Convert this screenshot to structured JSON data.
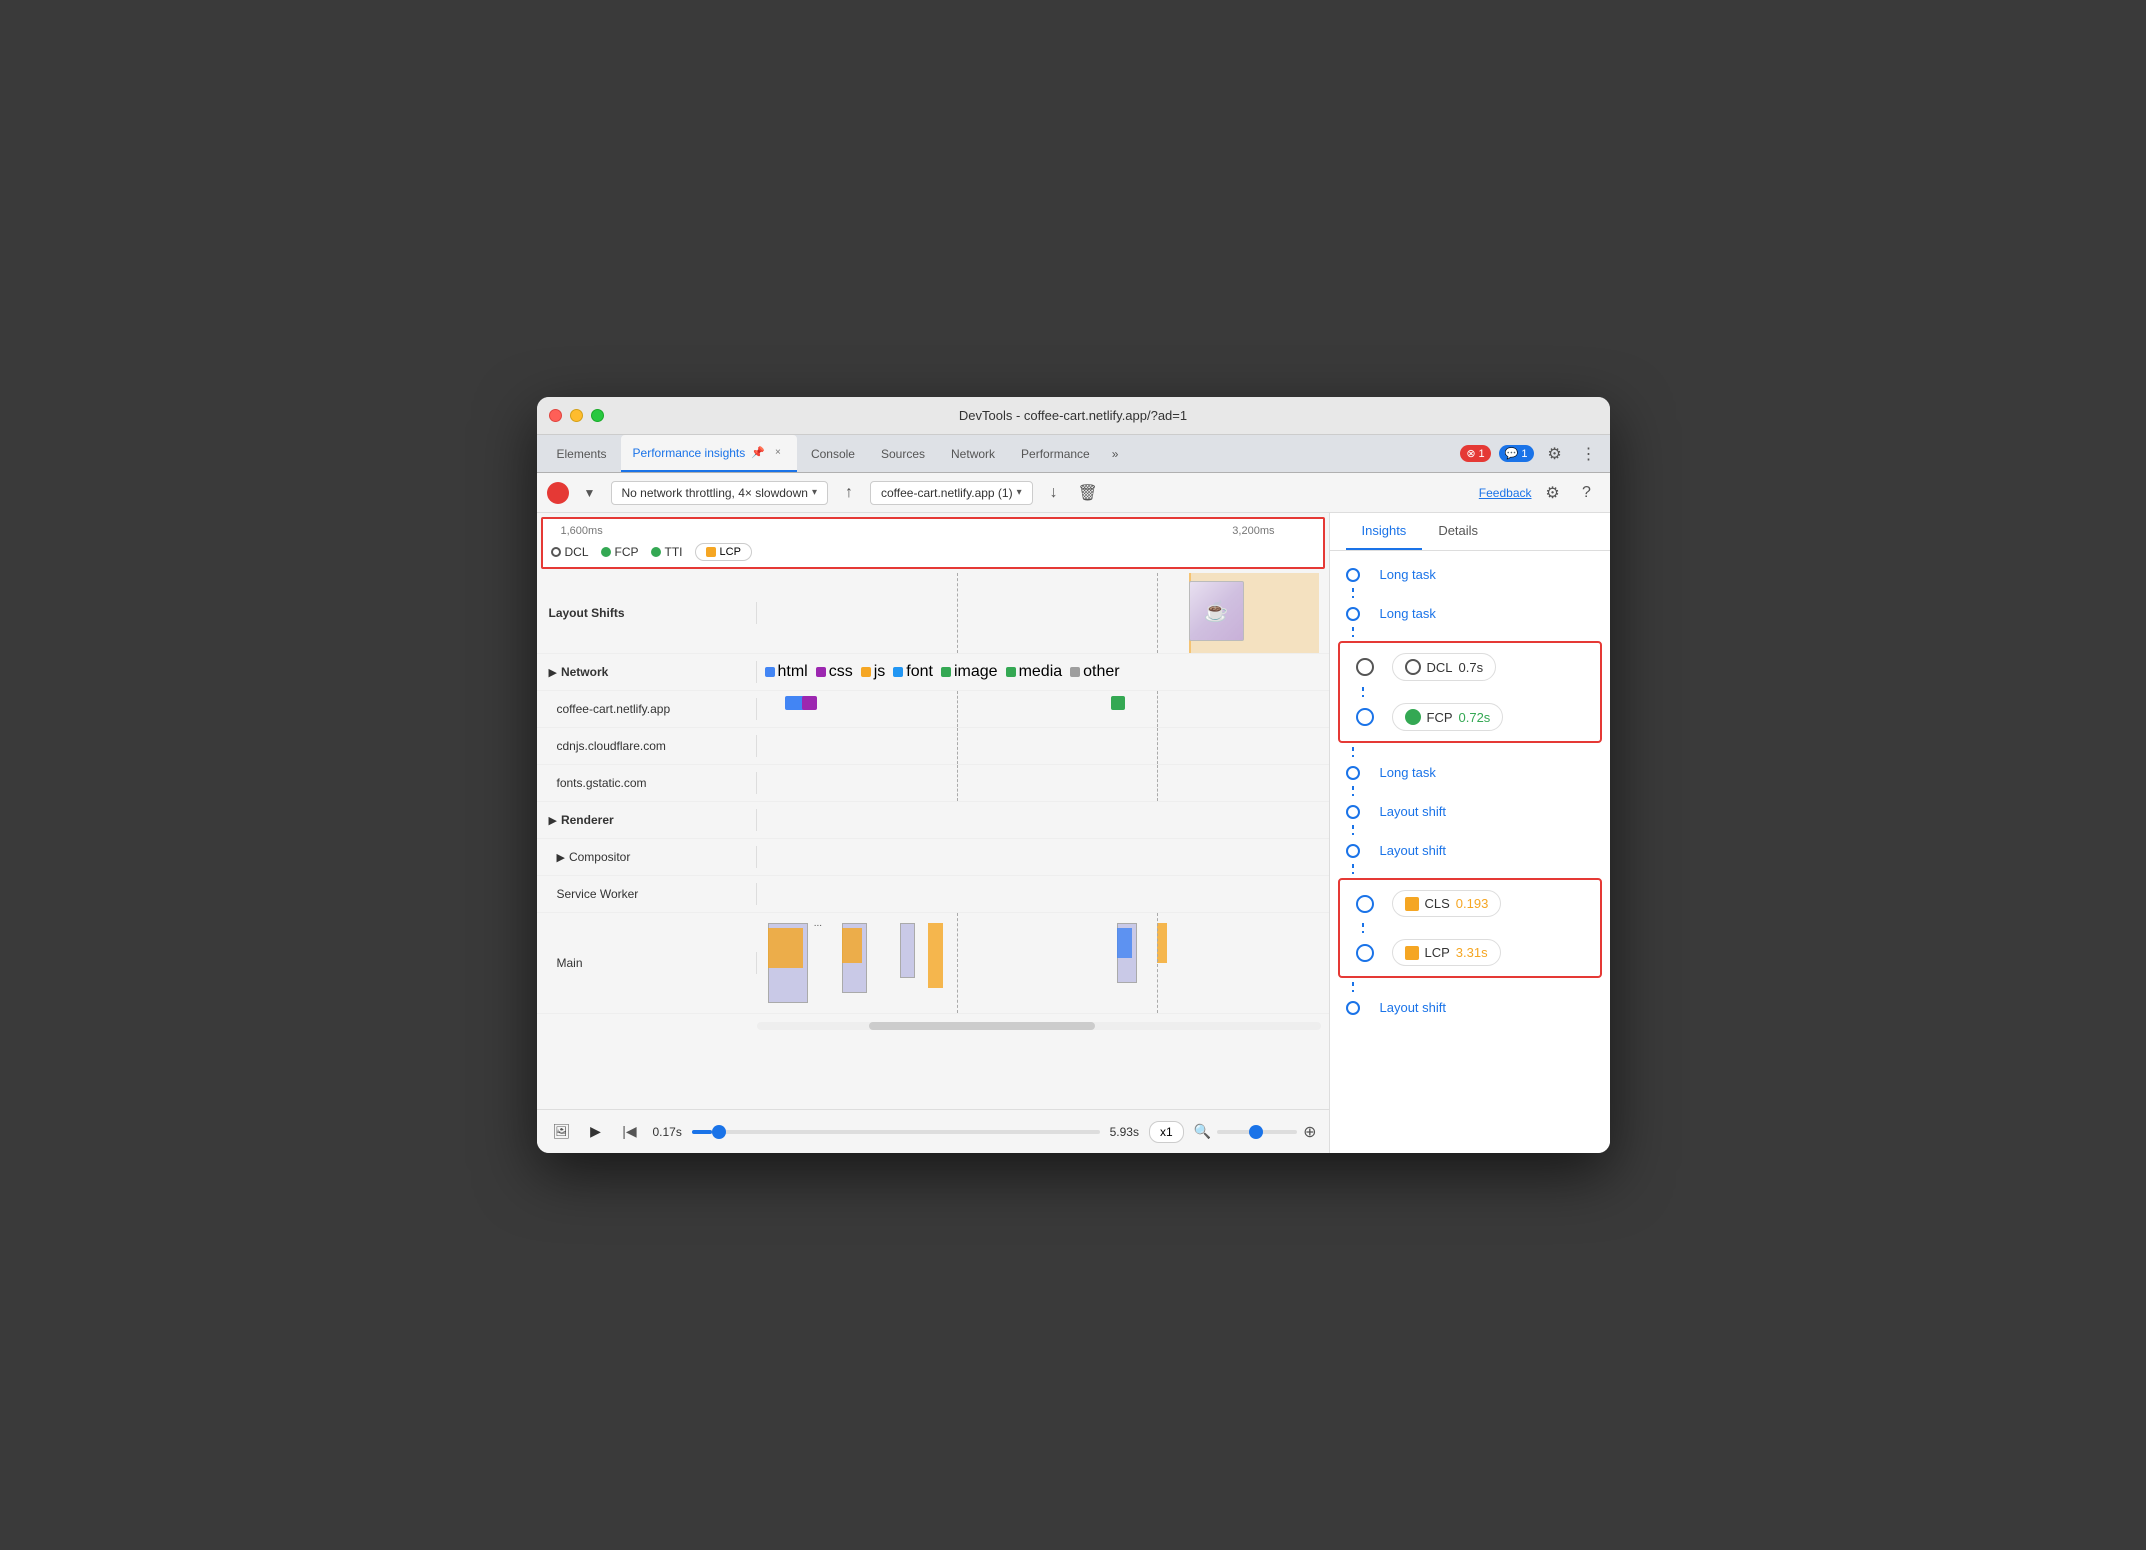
{
  "window": {
    "title": "DevTools - coffee-cart.netlify.app/?ad=1"
  },
  "tabs": {
    "items": [
      {
        "label": "Elements",
        "active": false
      },
      {
        "label": "Performance insights",
        "active": true,
        "has_close": true
      },
      {
        "label": "Console",
        "active": false
      },
      {
        "label": "Sources",
        "active": false
      },
      {
        "label": "Network",
        "active": false
      },
      {
        "label": "Performance",
        "active": false
      }
    ],
    "more_label": "»",
    "error_count": "1",
    "chat_count": "1"
  },
  "toolbar": {
    "network_throttle": "No network throttling, 4× slowdown",
    "url": "coffee-cart.netlify.app (1)",
    "feedback_label": "Feedback"
  },
  "timeline": {
    "marker_1600": "1,600ms",
    "marker_3200": "3,200ms",
    "metrics": [
      {
        "name": "DCL",
        "type": "empty"
      },
      {
        "name": "FCP",
        "type": "green"
      },
      {
        "name": "TTI",
        "type": "green"
      },
      {
        "name": "LCP",
        "type": "square"
      }
    ]
  },
  "tracks": {
    "layout_shifts_label": "Layout Shifts",
    "network_label": "▶ Network",
    "network_sites": [
      "coffee-cart.netlify.app",
      "cdnjs.cloudflare.com",
      "fonts.gstatic.com"
    ],
    "network_legend": {
      "items": [
        {
          "label": "html",
          "color": "#4285f4"
        },
        {
          "label": "css",
          "color": "#9c27b0"
        },
        {
          "label": "js",
          "color": "#f5a623"
        },
        {
          "label": "font",
          "color": "#2196f3"
        },
        {
          "label": "image",
          "color": "#34a853"
        },
        {
          "label": "media",
          "color": "#34a853"
        },
        {
          "label": "other",
          "color": "#9e9e9e"
        }
      ]
    },
    "renderer_label": "▶ Renderer",
    "compositor_label": "▶ Compositor",
    "service_worker_label": "Service Worker",
    "main_label": "Main"
  },
  "playback": {
    "start_time": "0.17s",
    "end_time": "5.93s",
    "speed": "x1",
    "position_pct": 5
  },
  "insights_panel": {
    "tabs": [
      "Insights",
      "Details"
    ],
    "items": [
      {
        "label": "Long task",
        "type": "link"
      },
      {
        "label": "Long task",
        "type": "link"
      },
      {
        "label": "DCL",
        "value": "0.7s",
        "value_color": "neutral",
        "type": "metric",
        "indicator": "empty"
      },
      {
        "label": "FCP",
        "value": "0.72s",
        "value_color": "green",
        "type": "metric",
        "indicator": "green"
      },
      {
        "label": "Long task",
        "type": "link"
      },
      {
        "label": "Layout shift",
        "type": "link"
      },
      {
        "label": "Layout shift",
        "type": "link"
      },
      {
        "label": "CLS",
        "value": "0.193",
        "value_color": "orange",
        "type": "metric",
        "indicator": "orange"
      },
      {
        "label": "LCP",
        "value": "3.31s",
        "value_color": "orange",
        "type": "metric",
        "indicator": "orange"
      },
      {
        "label": "Layout shift",
        "type": "link"
      }
    ]
  }
}
